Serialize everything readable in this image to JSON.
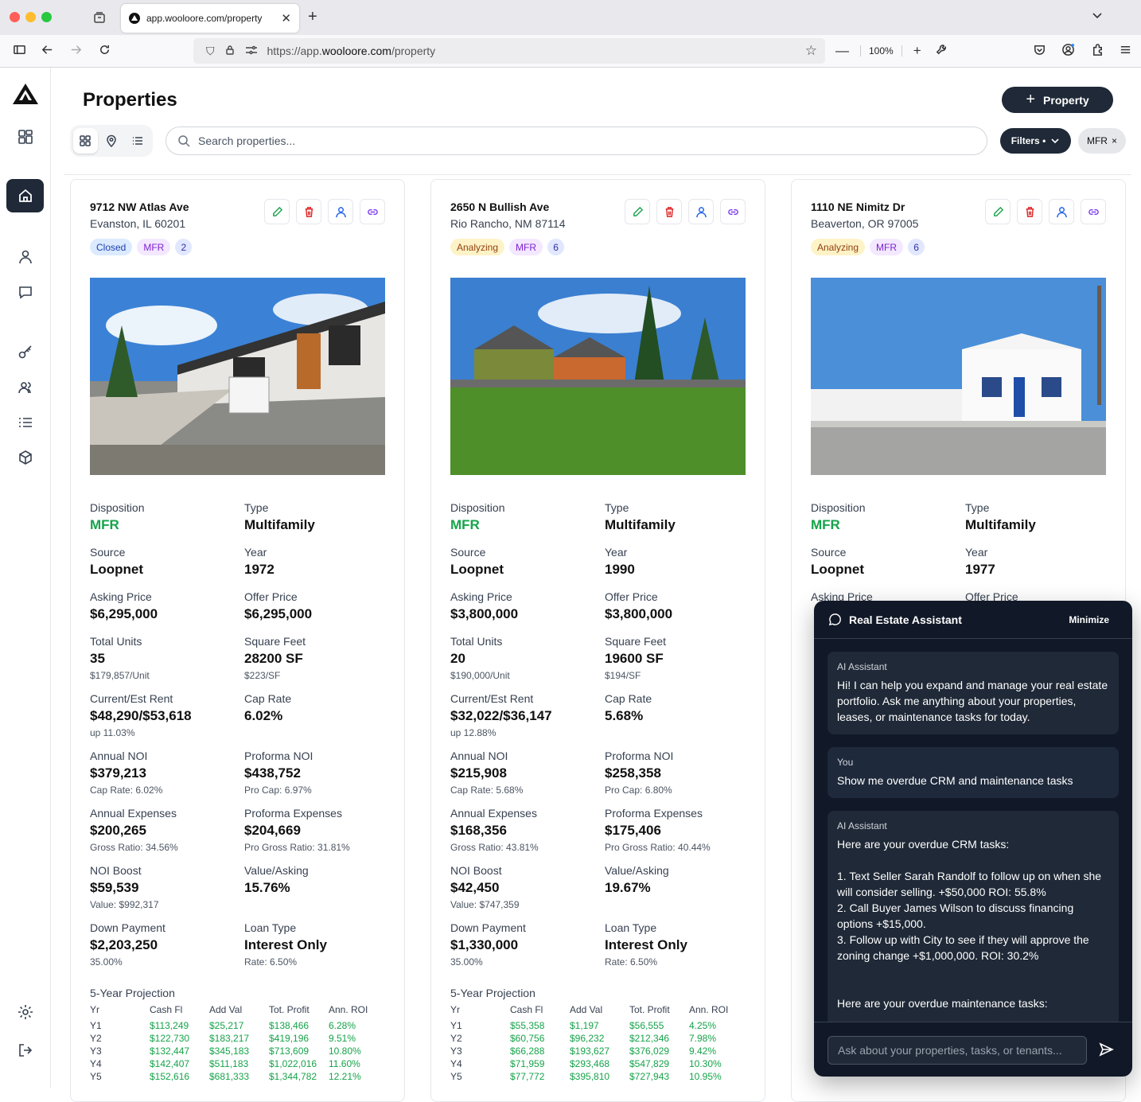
{
  "browser": {
    "tab_title": "app.wooloore.com/property",
    "url_prefix": "https://app.",
    "url_host": "wooloore.com",
    "url_path": "/property",
    "zoom": "100%"
  },
  "page": {
    "title": "Properties",
    "add_button": "Property",
    "search_placeholder": "Search properties...",
    "filters_label": "Filters •",
    "filter_chip": "MFR"
  },
  "field_labels": {
    "disposition": "Disposition",
    "type": "Type",
    "source": "Source",
    "year": "Year",
    "asking": "Asking Price",
    "offer": "Offer Price",
    "units": "Total Units",
    "sqft": "Square Feet",
    "rent": "Current/Est Rent",
    "cap": "Cap Rate",
    "noi": "Annual NOI",
    "pnoi": "Proforma NOI",
    "exp": "Annual Expenses",
    "pexp": "Proforma Expenses",
    "boost": "NOI Boost",
    "va": "Value/Asking",
    "down": "Down Payment",
    "loan": "Loan Type",
    "projection": "5-Year Projection"
  },
  "projection_headers": [
    "Yr",
    "Cash Fl",
    "Add Val",
    "Tot. Profit",
    "Ann. ROI"
  ],
  "properties": [
    {
      "address": "9712 NW Atlas Ave",
      "city": "Evanston, IL 60201",
      "status": "Closed",
      "tag": "MFR",
      "count": "2",
      "disposition": "MFR",
      "type": "Multifamily",
      "source": "Loopnet",
      "year": "1972",
      "asking": "$6,295,000",
      "offer": "$6,295,000",
      "units": "35",
      "per_unit": "$179,857/Unit",
      "sqft": "28200 SF",
      "per_sf": "$223/SF",
      "rent": "$48,290/$53,618",
      "rent_sub": "up 11.03%",
      "cap": "6.02%",
      "noi": "$379,213",
      "noi_sub": "Cap Rate: 6.02%",
      "pnoi": "$438,752",
      "pnoi_sub": "Pro Cap: 6.97%",
      "exp": "$200,265",
      "exp_sub": "Gross Ratio: 34.56%",
      "pexp": "$204,669",
      "pexp_sub": "Pro Gross Ratio: 31.81%",
      "boost": "$59,539",
      "boost_sub": "Value: $992,317",
      "va": "15.76%",
      "down": "$2,203,250",
      "down_sub": "35.00%",
      "loan": "Interest Only",
      "loan_sub": "Rate: 6.50%",
      "rows": [
        [
          "Y1",
          "$113,249",
          "$25,217",
          "$138,466",
          "6.28%"
        ],
        [
          "Y2",
          "$122,730",
          "$183,217",
          "$419,196",
          "9.51%"
        ],
        [
          "Y3",
          "$132,447",
          "$345,183",
          "$713,609",
          "10.80%"
        ],
        [
          "Y4",
          "$142,407",
          "$511,183",
          "$1,022,016",
          "11.60%"
        ],
        [
          "Y5",
          "$152,616",
          "$681,333",
          "$1,344,782",
          "12.21%"
        ]
      ]
    },
    {
      "address": "2650 N Bullish Ave",
      "city": "Rio Rancho, NM 87114",
      "status": "Analyzing",
      "tag": "MFR",
      "count": "6",
      "disposition": "MFR",
      "type": "Multifamily",
      "source": "Loopnet",
      "year": "1990",
      "asking": "$3,800,000",
      "offer": "$3,800,000",
      "units": "20",
      "per_unit": "$190,000/Unit",
      "sqft": "19600 SF",
      "per_sf": "$194/SF",
      "rent": "$32,022/$36,147",
      "rent_sub": "up 12.88%",
      "cap": "5.68%",
      "noi": "$215,908",
      "noi_sub": "Cap Rate: 5.68%",
      "pnoi": "$258,358",
      "pnoi_sub": "Pro Cap: 6.80%",
      "exp": "$168,356",
      "exp_sub": "Gross Ratio: 43.81%",
      "pexp": "$175,406",
      "pexp_sub": "Pro Gross Ratio: 40.44%",
      "boost": "$42,450",
      "boost_sub": "Value: $747,359",
      "va": "19.67%",
      "down": "$1,330,000",
      "down_sub": "35.00%",
      "loan": "Interest Only",
      "loan_sub": "Rate: 6.50%",
      "rows": [
        [
          "Y1",
          "$55,358",
          "$1,197",
          "$56,555",
          "4.25%"
        ],
        [
          "Y2",
          "$60,756",
          "$96,232",
          "$212,346",
          "7.98%"
        ],
        [
          "Y3",
          "$66,288",
          "$193,627",
          "$376,029",
          "9.42%"
        ],
        [
          "Y4",
          "$71,959",
          "$293,468",
          "$547,829",
          "10.30%"
        ],
        [
          "Y5",
          "$77,772",
          "$395,810",
          "$727,943",
          "10.95%"
        ]
      ]
    },
    {
      "address": "1110 NE Nimitz Dr",
      "city": "Beaverton, OR 97005",
      "status": "Analyzing",
      "tag": "MFR",
      "count": "6",
      "disposition": "MFR",
      "type": "Multifamily",
      "source": "Loopnet",
      "year": "1977",
      "asking": "",
      "offer": ""
    }
  ],
  "chat": {
    "title": "Real Estate Assistant",
    "minimize": "Minimize",
    "input_placeholder": "Ask about your properties, tasks, or tenants...",
    "messages": [
      {
        "who": "AI Assistant",
        "text": "Hi! I can help you expand and manage your real estate portfolio. Ask me anything about your properties, leases, or maintenance tasks for today."
      },
      {
        "who": "You",
        "text": "Show me overdue CRM and maintenance tasks"
      },
      {
        "who": "AI Assistant",
        "text": "Here are your overdue CRM tasks:\n\n1. Text Seller Sarah Randolf to follow up on when she will consider selling. +$50,000 ROI: 55.8%\n2. Call Buyer James Wilson to discuss financing options +$15,000.\n3. Follow up with City to see if they will approve the zoning change +$1,000,000. ROI: 30.2%\n\n\nHere are your overdue maintenance tasks:"
      }
    ]
  }
}
